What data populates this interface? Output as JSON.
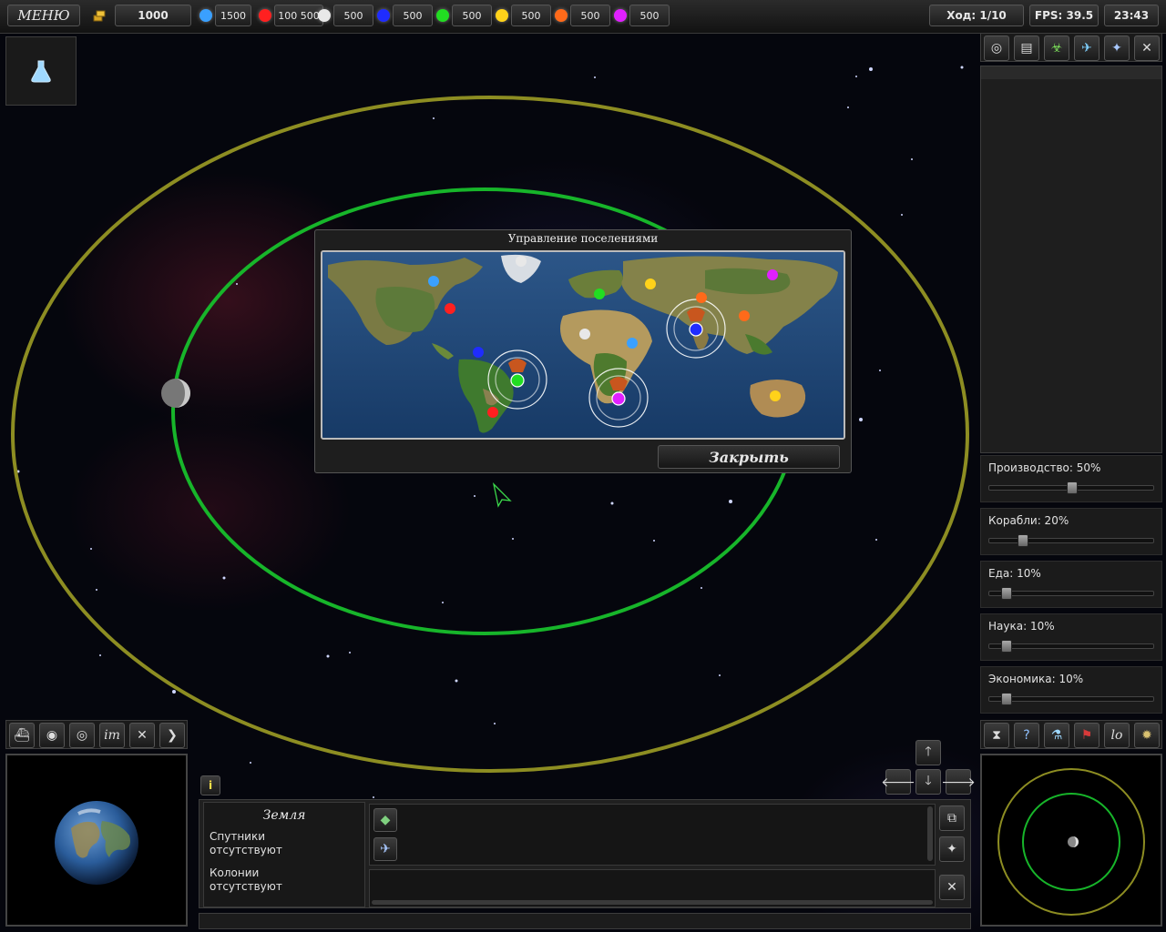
{
  "topbar": {
    "menu_label": "МЕНЮ",
    "gold_value": "1000",
    "resources": [
      {
        "color": "#3aa0ff",
        "value": "1500"
      },
      {
        "color": "#ff2020",
        "value": "100 500"
      },
      {
        "color": "#e8e8e8",
        "value": "500"
      },
      {
        "color": "#1f2cff",
        "value": "500"
      },
      {
        "color": "#22dd22",
        "value": "500"
      },
      {
        "color": "#ffd21a",
        "value": "500"
      },
      {
        "color": "#ff6a1a",
        "value": "500"
      },
      {
        "color": "#e020ff",
        "value": "500"
      }
    ],
    "turn": "Ход: 1/10",
    "fps": "FPS: 39.5",
    "clock": "23:43"
  },
  "dialog": {
    "title": "Управление поселениями",
    "close_label": "Закрыть"
  },
  "sliders": [
    {
      "label": "Производство: 50%",
      "value": 0.5
    },
    {
      "label": "Корабли: 20%",
      "value": 0.2
    },
    {
      "label": "Еда: 10%",
      "value": 0.1
    },
    {
      "label": "Наука: 10%",
      "value": 0.1
    },
    {
      "label": "Экономика: 10%",
      "value": 0.1
    }
  ],
  "planet_info": {
    "name": "Земля",
    "satellites_label": "Спутники",
    "satellites_value": "отсутствуют",
    "colonies_label": "Колонии",
    "colonies_value": "отсутствуют"
  },
  "toolbar_left": {
    "im_label": "im"
  },
  "right_icons": {
    "log_label": "lo"
  }
}
